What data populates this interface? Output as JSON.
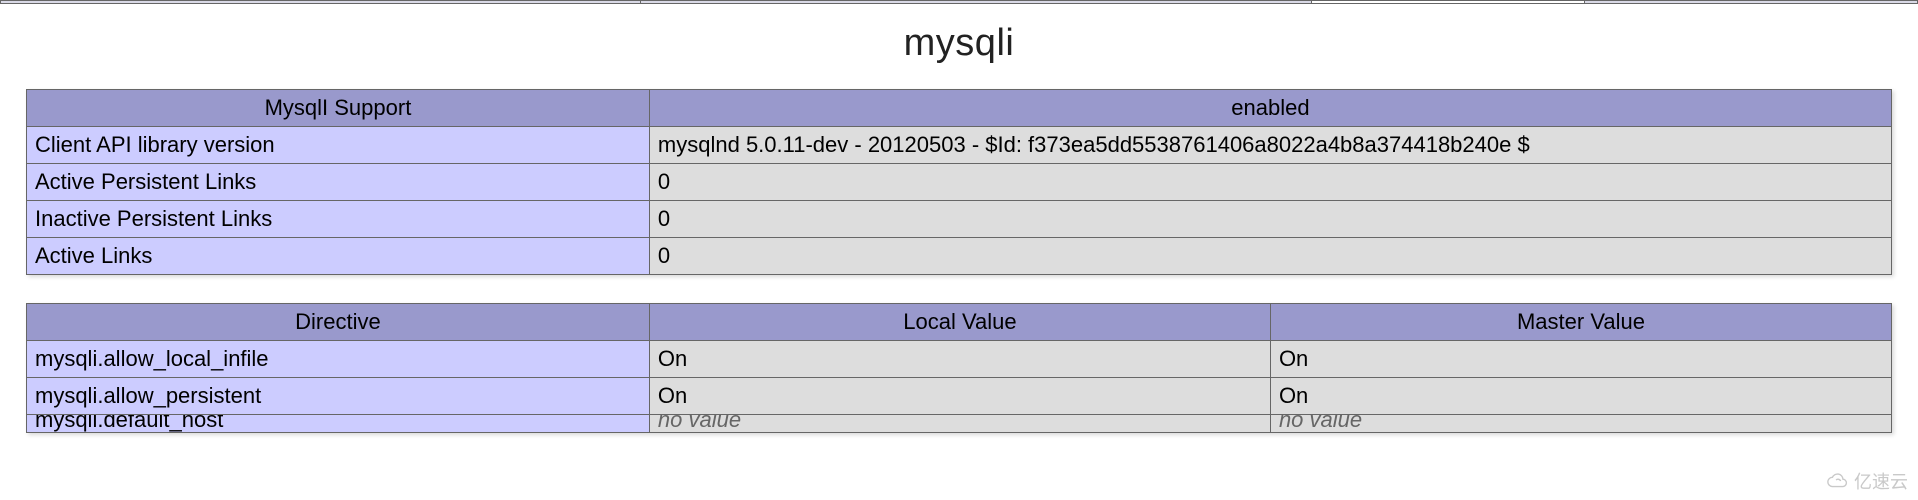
{
  "section_title": "mysqli",
  "info_table": {
    "header": {
      "left": "MysqlI Support",
      "right": "enabled"
    },
    "rows": [
      {
        "label": "Client API library version",
        "value": "mysqlnd 5.0.11-dev - 20120503 - $Id: f373ea5dd5538761406a8022a4b8a374418b240e $"
      },
      {
        "label": "Active Persistent Links",
        "value": "0"
      },
      {
        "label": "Inactive Persistent Links",
        "value": "0"
      },
      {
        "label": "Active Links",
        "value": "0"
      }
    ]
  },
  "directive_table": {
    "headers": {
      "directive": "Directive",
      "local": "Local Value",
      "master": "Master Value"
    },
    "rows": [
      {
        "directive": "mysqli.allow_local_infile",
        "local": "On",
        "master": "On"
      },
      {
        "directive": "mysqli.allow_persistent",
        "local": "On",
        "master": "On"
      },
      {
        "directive": "mysqli.default_host",
        "local": "no value",
        "master": "no value",
        "novalue": true
      }
    ]
  },
  "watermark": "亿速云"
}
